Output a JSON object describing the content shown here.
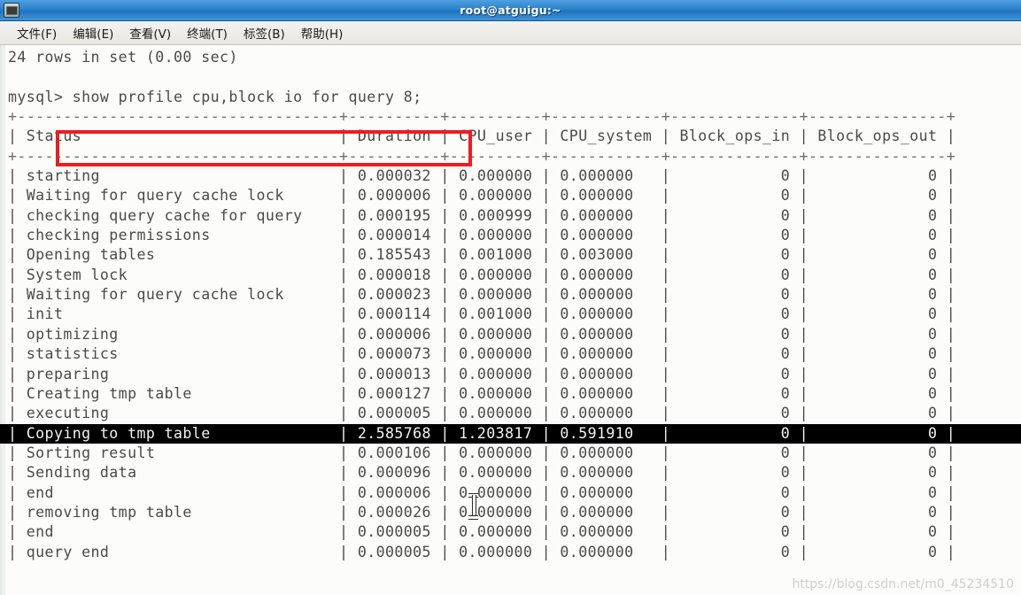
{
  "window": {
    "title": "root@atguigu:~",
    "icon": "terminal-icon"
  },
  "menubar": {
    "items": [
      {
        "label": "文件(F)",
        "name": "menu-file"
      },
      {
        "label": "编辑(E)",
        "name": "menu-edit"
      },
      {
        "label": "查看(V)",
        "name": "menu-view"
      },
      {
        "label": "终端(T)",
        "name": "menu-terminal"
      },
      {
        "label": "标签(B)",
        "name": "menu-tabs"
      },
      {
        "label": "帮助(H)",
        "name": "menu-help"
      }
    ]
  },
  "terminal": {
    "result_notice": "24 rows in set (0.00 sec)",
    "prompt": "mysql> ",
    "command": "show profile cpu,block io for query 8;",
    "annotation_color": "#ee1c21",
    "separator_top": "+-----------------------------------+----------+----------+------------+--------------+---------------+",
    "separator_header": "+-----------------------------------+----------+----------+------------+--------------+---------------+",
    "headers": [
      "Status",
      "Duration",
      "CPU_user",
      "CPU_system",
      "Block_ops_in",
      "Block_ops_out"
    ],
    "highlight_row_index": 13,
    "rows": [
      {
        "status": "starting",
        "duration": "0.000032",
        "cpu_user": "0.000000",
        "cpu_system": "0.000000",
        "block_ops_in": "0",
        "block_ops_out": "0"
      },
      {
        "status": "Waiting for query cache lock",
        "duration": "0.000006",
        "cpu_user": "0.000000",
        "cpu_system": "0.000000",
        "block_ops_in": "0",
        "block_ops_out": "0"
      },
      {
        "status": "checking query cache for query",
        "duration": "0.000195",
        "cpu_user": "0.000999",
        "cpu_system": "0.000000",
        "block_ops_in": "0",
        "block_ops_out": "0"
      },
      {
        "status": "checking permissions",
        "duration": "0.000014",
        "cpu_user": "0.000000",
        "cpu_system": "0.000000",
        "block_ops_in": "0",
        "block_ops_out": "0"
      },
      {
        "status": "Opening tables",
        "duration": "0.185543",
        "cpu_user": "0.001000",
        "cpu_system": "0.003000",
        "block_ops_in": "0",
        "block_ops_out": "0"
      },
      {
        "status": "System lock",
        "duration": "0.000018",
        "cpu_user": "0.000000",
        "cpu_system": "0.000000",
        "block_ops_in": "0",
        "block_ops_out": "0"
      },
      {
        "status": "Waiting for query cache lock",
        "duration": "0.000023",
        "cpu_user": "0.000000",
        "cpu_system": "0.000000",
        "block_ops_in": "0",
        "block_ops_out": "0"
      },
      {
        "status": "init",
        "duration": "0.000114",
        "cpu_user": "0.001000",
        "cpu_system": "0.000000",
        "block_ops_in": "0",
        "block_ops_out": "0"
      },
      {
        "status": "optimizing",
        "duration": "0.000006",
        "cpu_user": "0.000000",
        "cpu_system": "0.000000",
        "block_ops_in": "0",
        "block_ops_out": "0"
      },
      {
        "status": "statistics",
        "duration": "0.000073",
        "cpu_user": "0.000000",
        "cpu_system": "0.000000",
        "block_ops_in": "0",
        "block_ops_out": "0"
      },
      {
        "status": "preparing",
        "duration": "0.000013",
        "cpu_user": "0.000000",
        "cpu_system": "0.000000",
        "block_ops_in": "0",
        "block_ops_out": "0"
      },
      {
        "status": "Creating tmp table",
        "duration": "0.000127",
        "cpu_user": "0.000000",
        "cpu_system": "0.000000",
        "block_ops_in": "0",
        "block_ops_out": "0"
      },
      {
        "status": "executing",
        "duration": "0.000005",
        "cpu_user": "0.000000",
        "cpu_system": "0.000000",
        "block_ops_in": "0",
        "block_ops_out": "0"
      },
      {
        "status": "Copying to tmp table",
        "duration": "2.585768",
        "cpu_user": "1.203817",
        "cpu_system": "0.591910",
        "block_ops_in": "0",
        "block_ops_out": "0"
      },
      {
        "status": "Sorting result",
        "duration": "0.000106",
        "cpu_user": "0.000000",
        "cpu_system": "0.000000",
        "block_ops_in": "0",
        "block_ops_out": "0"
      },
      {
        "status": "Sending data",
        "duration": "0.000096",
        "cpu_user": "0.000000",
        "cpu_system": "0.000000",
        "block_ops_in": "0",
        "block_ops_out": "0"
      },
      {
        "status": "end",
        "duration": "0.000006",
        "cpu_user": "0.000000",
        "cpu_system": "0.000000",
        "block_ops_in": "0",
        "block_ops_out": "0"
      },
      {
        "status": "removing tmp table",
        "duration": "0.000026",
        "cpu_user": "0.000000",
        "cpu_system": "0.000000",
        "block_ops_in": "0",
        "block_ops_out": "0"
      },
      {
        "status": "end",
        "duration": "0.000005",
        "cpu_user": "0.000000",
        "cpu_system": "0.000000",
        "block_ops_in": "0",
        "block_ops_out": "0"
      },
      {
        "status": "query end",
        "duration": "0.000005",
        "cpu_user": "0.000000",
        "cpu_system": "0.000000",
        "block_ops_in": "0",
        "block_ops_out": "0"
      }
    ]
  },
  "watermark": {
    "text": "https://blog.csdn.net/m0_45234510"
  }
}
